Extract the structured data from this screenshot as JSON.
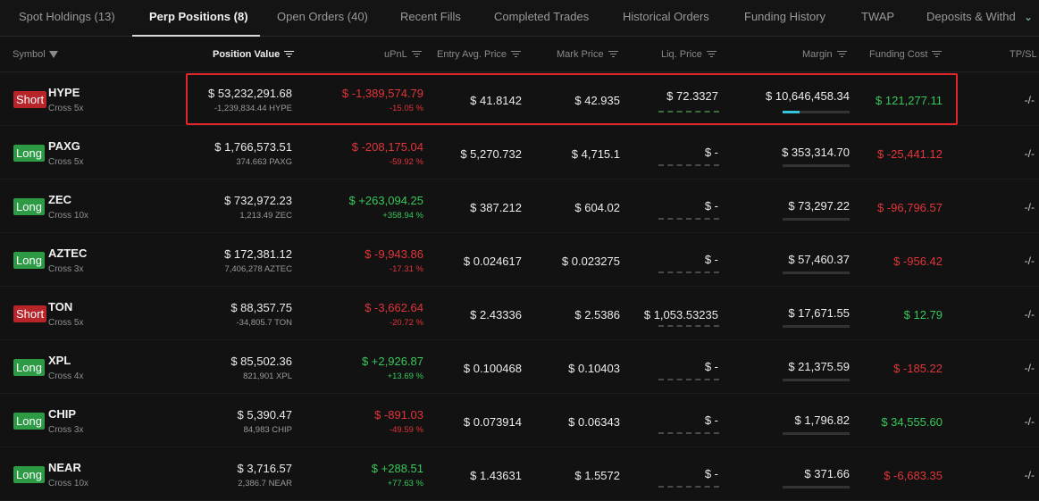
{
  "tabs": [
    {
      "label": "Spot Holdings (13)",
      "active": false
    },
    {
      "label": "Perp Positions (8)",
      "active": true
    },
    {
      "label": "Open Orders (40)",
      "active": false
    },
    {
      "label": "Recent Fills",
      "active": false
    },
    {
      "label": "Completed Trades",
      "active": false
    },
    {
      "label": "Historical Orders",
      "active": false
    },
    {
      "label": "Funding History",
      "active": false
    },
    {
      "label": "TWAP",
      "active": false
    },
    {
      "label": "Deposits & Withd",
      "active": false
    }
  ],
  "columns": {
    "symbol": "Symbol",
    "position_value": "Position Value",
    "upnl": "uPnL",
    "entry": "Entry Avg. Price",
    "mark": "Mark Price",
    "liq": "Liq. Price",
    "margin": "Margin",
    "funding": "Funding Cost",
    "tpsl": "TP/SL"
  },
  "colors": {
    "long": "#2d9a44",
    "short": "#b8242a",
    "gain": "#38c75a",
    "loss": "#e0353a",
    "highlight": "#e0262b",
    "margin_fill": "#35c5d8"
  },
  "positions": [
    {
      "side": "Short",
      "symbol": "HYPE",
      "leverage": "Cross 5x",
      "value": "$ 53,232,291.68",
      "size": "-1,239,834.44 HYPE",
      "upnl": "$ -1,389,574.79",
      "upnl_pct": "-15.05 %",
      "upnl_sign": "neg",
      "entry": "$ 41.8142",
      "mark": "$ 42.935",
      "liq": "$ 72.3327",
      "margin": "$ 10,646,458.34",
      "margin_fill": 0.25,
      "funding": "$ 121,277.11",
      "funding_sign": "pos",
      "tpsl": "-/-"
    },
    {
      "side": "Long",
      "symbol": "PAXG",
      "leverage": "Cross 5x",
      "value": "$ 1,766,573.51",
      "size": "374.663 PAXG",
      "upnl": "$ -208,175.04",
      "upnl_pct": "-59.92 %",
      "upnl_sign": "neg",
      "entry": "$ 5,270.732",
      "mark": "$ 4,715.1",
      "liq": "$ -",
      "margin": "$ 353,314.70",
      "margin_fill": 0,
      "funding": "$ -25,441.12",
      "funding_sign": "neg",
      "tpsl": "-/-"
    },
    {
      "side": "Long",
      "symbol": "ZEC",
      "leverage": "Cross 10x",
      "value": "$ 732,972.23",
      "size": "1,213.49 ZEC",
      "upnl": "$ +263,094.25",
      "upnl_pct": "+358.94 %",
      "upnl_sign": "pos",
      "entry": "$ 387.212",
      "mark": "$ 604.02",
      "liq": "$ -",
      "margin": "$ 73,297.22",
      "margin_fill": 0,
      "funding": "$ -96,796.57",
      "funding_sign": "neg",
      "tpsl": "-/-"
    },
    {
      "side": "Long",
      "symbol": "AZTEC",
      "leverage": "Cross 3x",
      "value": "$ 172,381.12",
      "size": "7,406,278 AZTEC",
      "upnl": "$ -9,943.86",
      "upnl_pct": "-17.31 %",
      "upnl_sign": "neg",
      "entry": "$ 0.024617",
      "mark": "$ 0.023275",
      "liq": "$ -",
      "margin": "$ 57,460.37",
      "margin_fill": 0,
      "funding": "$ -956.42",
      "funding_sign": "neg",
      "tpsl": "-/-"
    },
    {
      "side": "Short",
      "symbol": "TON",
      "leverage": "Cross 5x",
      "value": "$ 88,357.75",
      "size": "-34,805.7 TON",
      "upnl": "$ -3,662.64",
      "upnl_pct": "-20.72 %",
      "upnl_sign": "neg",
      "entry": "$ 2.43336",
      "mark": "$ 2.5386",
      "liq": "$ 1,053.53235",
      "margin": "$ 17,671.55",
      "margin_fill": 0,
      "funding": "$ 12.79",
      "funding_sign": "pos",
      "tpsl": "-/-"
    },
    {
      "side": "Long",
      "symbol": "XPL",
      "leverage": "Cross 4x",
      "value": "$ 85,502.36",
      "size": "821,901 XPL",
      "upnl": "$ +2,926.87",
      "upnl_pct": "+13.69 %",
      "upnl_sign": "pos",
      "entry": "$ 0.100468",
      "mark": "$ 0.10403",
      "liq": "$ -",
      "margin": "$ 21,375.59",
      "margin_fill": 0,
      "funding": "$ -185.22",
      "funding_sign": "neg",
      "tpsl": "-/-"
    },
    {
      "side": "Long",
      "symbol": "CHIP",
      "leverage": "Cross 3x",
      "value": "$ 5,390.47",
      "size": "84,983 CHIP",
      "upnl": "$ -891.03",
      "upnl_pct": "-49.59 %",
      "upnl_sign": "neg",
      "entry": "$ 0.073914",
      "mark": "$ 0.06343",
      "liq": "$ -",
      "margin": "$ 1,796.82",
      "margin_fill": 0,
      "funding": "$ 34,555.60",
      "funding_sign": "pos",
      "tpsl": "-/-"
    },
    {
      "side": "Long",
      "symbol": "NEAR",
      "leverage": "Cross 10x",
      "value": "$ 3,716.57",
      "size": "2,386.7 NEAR",
      "upnl": "$ +288.51",
      "upnl_pct": "+77.63 %",
      "upnl_sign": "pos",
      "entry": "$ 1.43631",
      "mark": "$ 1.5572",
      "liq": "$ -",
      "margin": "$ 371.66",
      "margin_fill": 0,
      "funding": "$ -6,683.35",
      "funding_sign": "neg",
      "tpsl": "-/-"
    }
  ]
}
